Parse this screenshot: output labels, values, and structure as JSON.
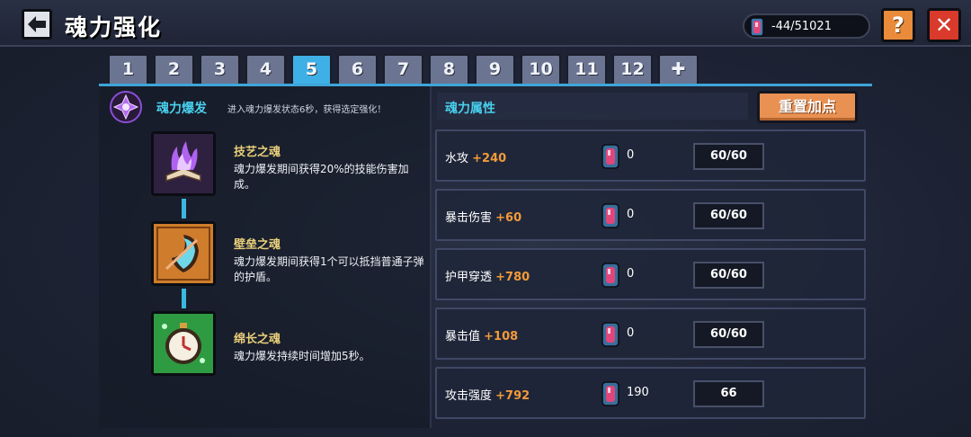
{
  "header": {
    "title": "魂力强化",
    "currency_value": "-44/51021",
    "help_label": "?",
    "close_label": "✕"
  },
  "tabs": [
    "1",
    "2",
    "3",
    "4",
    "5",
    "6",
    "7",
    "8",
    "9",
    "10",
    "11",
    "12",
    "✚"
  ],
  "active_tab": "5",
  "burst": {
    "title": "魂力爆发",
    "description": "进入魂力爆发状态6秒，获得选定强化！"
  },
  "skills": [
    {
      "name": "技艺之魂",
      "description": "魂力爆发期间获得20%的技能伤害加成。",
      "icon": "purple-flame-book-icon"
    },
    {
      "name": "壁垒之魂",
      "description": "魂力爆发期间获得1个可以抵挡普通子弹的护盾。",
      "icon": "shield-icon"
    },
    {
      "name": "绵长之魂",
      "description": "魂力爆发持续时间增加5秒。",
      "icon": "stopwatch-icon"
    }
  ],
  "attributes_header": "魂力属性",
  "reset_label": "重置加点",
  "attributes": [
    {
      "name": "水攻",
      "bonus": "+240",
      "cost": "0",
      "level": "60/60"
    },
    {
      "name": "暴击伤害",
      "bonus": "+60",
      "cost": "0",
      "level": "60/60"
    },
    {
      "name": "护甲穿透",
      "bonus": "+780",
      "cost": "0",
      "level": "60/60"
    },
    {
      "name": "暴击值",
      "bonus": "+108",
      "cost": "0",
      "level": "60/60"
    },
    {
      "name": "攻击强度",
      "bonus": "+792",
      "cost": "190",
      "level": "66"
    }
  ],
  "colors": {
    "accent_blue": "#3fb0e6",
    "bonus_orange": "#f29a3a",
    "close_red": "#d93a2b",
    "help_orange": "#e98b3a"
  }
}
